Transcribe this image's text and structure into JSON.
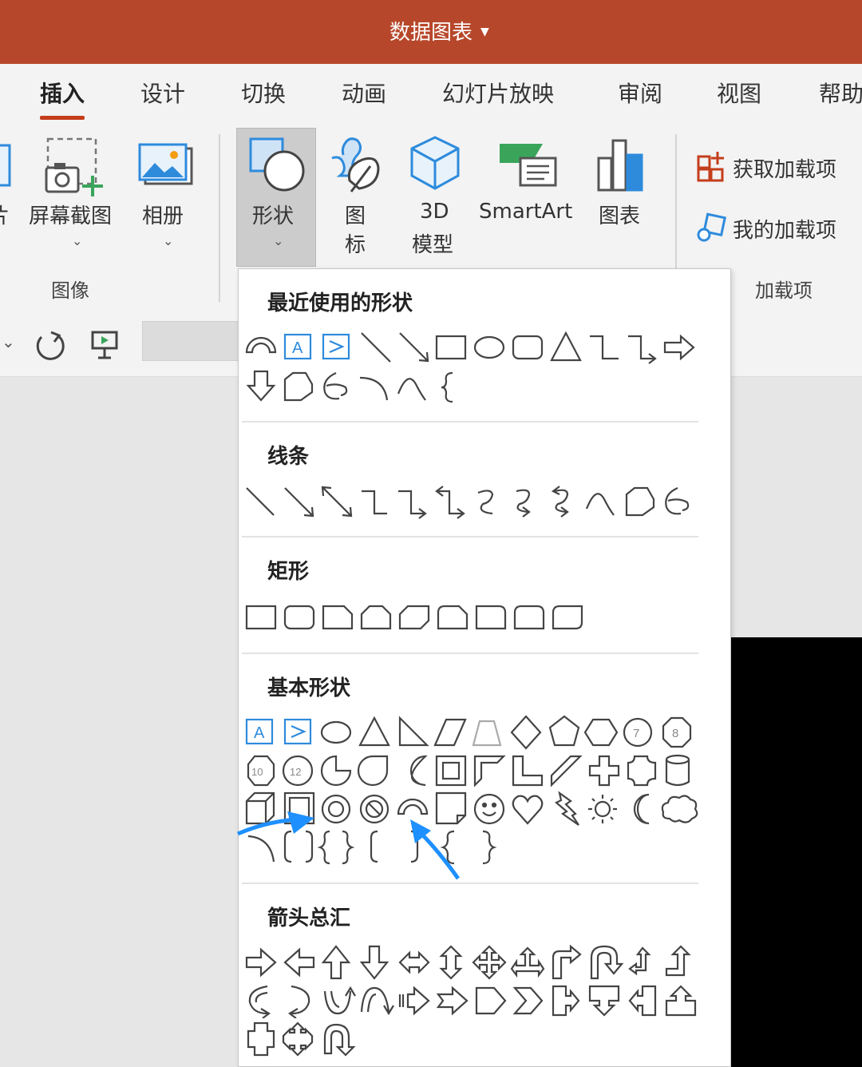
{
  "window": {
    "title": "数据图表"
  },
  "tabs": [
    "插入",
    "设计",
    "切换",
    "动画",
    "幻灯片放映",
    "审阅",
    "视图",
    "帮助"
  ],
  "ribbon": {
    "screenshot_label": "屏幕截图",
    "album_label": "相册",
    "image_group_label": "图像",
    "shape_label": "形状",
    "icon_label_1": "图",
    "icon_label_2": "标",
    "model3d_label_1": "3D",
    "model3d_label_2": "模型",
    "smartart_label": "SmartArt",
    "chart_label": "图表",
    "get_addins_label": "获取加载项",
    "my_addins_label": "我的加载项",
    "addins_group_label": "加载项",
    "accent_color": "#b7472a",
    "icon_blue": "#2e8bdc",
    "icon_green": "#3aa55a"
  },
  "shapes_panel": {
    "sections": [
      {
        "title": "最近使用的形状"
      },
      {
        "title": "线条"
      },
      {
        "title": "矩形"
      },
      {
        "title": "基本形状"
      },
      {
        "title": "箭头总汇"
      }
    ],
    "annotation_color": "#1e90ff"
  }
}
